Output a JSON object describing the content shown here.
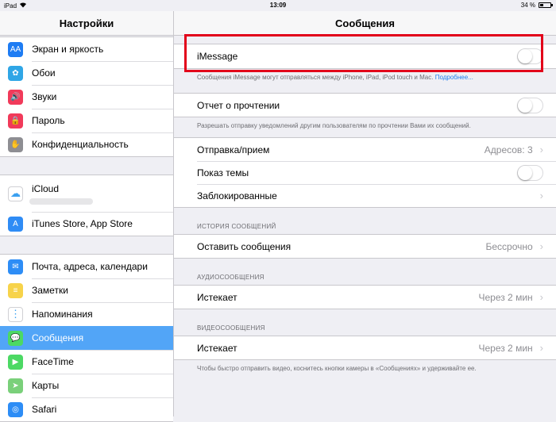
{
  "status_bar": {
    "device": "iPad",
    "time": "13:09",
    "battery_percent": "34 %",
    "battery_level": 0.34
  },
  "sidebar": {
    "title": "Настройки",
    "groups": [
      [
        {
          "label": "Экран и яркость",
          "icon": "display-brightness-icon",
          "color": "#1e7cf3",
          "glyph": "AA"
        },
        {
          "label": "Обои",
          "icon": "wallpaper-icon",
          "color": "#2fa6e6",
          "glyph": "✿"
        },
        {
          "label": "Звуки",
          "icon": "sounds-icon",
          "color": "#f13a5a",
          "glyph": "🔊"
        },
        {
          "label": "Пароль",
          "icon": "passcode-icon",
          "color": "#f13a5a",
          "glyph": "🔒"
        },
        {
          "label": "Конфиденциальность",
          "icon": "privacy-icon",
          "color": "#8e8e93",
          "glyph": "✋"
        }
      ],
      [
        {
          "label": "iCloud",
          "icon": "icloud-icon",
          "color": "#ffffff",
          "glyph": "☁"
        },
        {
          "label": "iTunes Store, App Store",
          "icon": "app-store-icon",
          "color": "#2f8cf5",
          "glyph": "A"
        }
      ],
      [
        {
          "label": "Почта, адреса, календари",
          "icon": "mail-icon",
          "color": "#2d8df6",
          "glyph": "✉"
        },
        {
          "label": "Заметки",
          "icon": "notes-icon",
          "color": "#f7d34a",
          "glyph": "≡"
        },
        {
          "label": "Напоминания",
          "icon": "reminders-icon",
          "color": "#ffffff",
          "glyph": "⋮"
        },
        {
          "label": "Сообщения",
          "icon": "messages-icon",
          "color": "#4cd964",
          "glyph": "💬",
          "selected": true
        },
        {
          "label": "FaceTime",
          "icon": "facetime-icon",
          "color": "#4cd964",
          "glyph": "▶"
        },
        {
          "label": "Карты",
          "icon": "maps-icon",
          "color": "#7ad07a",
          "glyph": "➤"
        },
        {
          "label": "Safari",
          "icon": "safari-icon",
          "color": "#2d8df6",
          "glyph": "◎"
        }
      ]
    ]
  },
  "main": {
    "title": "Сообщения",
    "imessage": {
      "label": "iMessage",
      "on": false
    },
    "imessage_note": "Сообщения iMessage могут отправляться между iPhone, iPad, iPod touch и Mac.",
    "imessage_link": "Подробнее...",
    "read_receipts": {
      "label": "Отчет о прочтении",
      "on": false
    },
    "read_receipts_note": "Разрешать отправку уведомлений другим пользователям по прочтении Вами их сообщений.",
    "send_receive": {
      "label": "Отправка/прием",
      "value": "Адресов: 3"
    },
    "show_subject": {
      "label": "Показ темы",
      "on": false
    },
    "blocked": {
      "label": "Заблокированные"
    },
    "history_header": "ИСТОРИЯ СООБЩЕНИЙ",
    "keep_messages": {
      "label": "Оставить сообщения",
      "value": "Бессрочно"
    },
    "audio_header": "АУДИОСООБЩЕНИЯ",
    "audio_expire": {
      "label": "Истекает",
      "value": "Через 2 мин"
    },
    "video_header": "ВИДЕОСООБЩЕНИЯ",
    "video_expire": {
      "label": "Истекает",
      "value": "Через 2 мин"
    },
    "video_note": "Чтобы быстро отправить видео, коснитесь кнопки камеры в «Сообщениях» и удерживайте ее."
  },
  "colors": {
    "accent": "#1d7ef0",
    "selected": "#52a5f7",
    "highlight": "#e2001a"
  }
}
